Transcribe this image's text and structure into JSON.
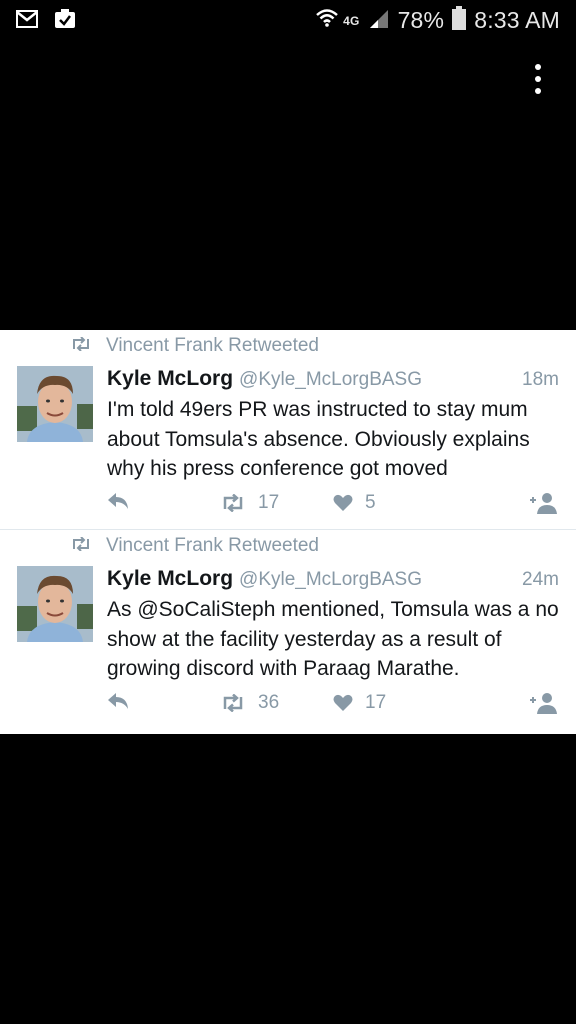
{
  "status_bar": {
    "network": "4G",
    "battery": "78%",
    "time": "8:33 AM"
  },
  "tweets": [
    {
      "retweeted_by": "Vincent Frank Retweeted",
      "name": "Kyle McLorg",
      "handle": "@Kyle_McLorgBASG",
      "time": "18m",
      "text": "I'm told 49ers PR was instructed to stay mum about Tomsula's absence. Obviously explains why his press conference got moved",
      "retweets": "17",
      "likes": "5"
    },
    {
      "retweeted_by": "Vincent Frank Retweeted",
      "name": "Kyle McLorg",
      "handle": "@Kyle_McLorgBASG",
      "time": "24m",
      "text": "As @SoCaliSteph mentioned, Tomsula was a no show at the facility yesterday as a result of growing discord with Paraag Marathe.",
      "retweets": "36",
      "likes": "17"
    }
  ],
  "colors": {
    "accent_gray": "#8899a6",
    "text": "#14171a",
    "background": "#000000"
  }
}
